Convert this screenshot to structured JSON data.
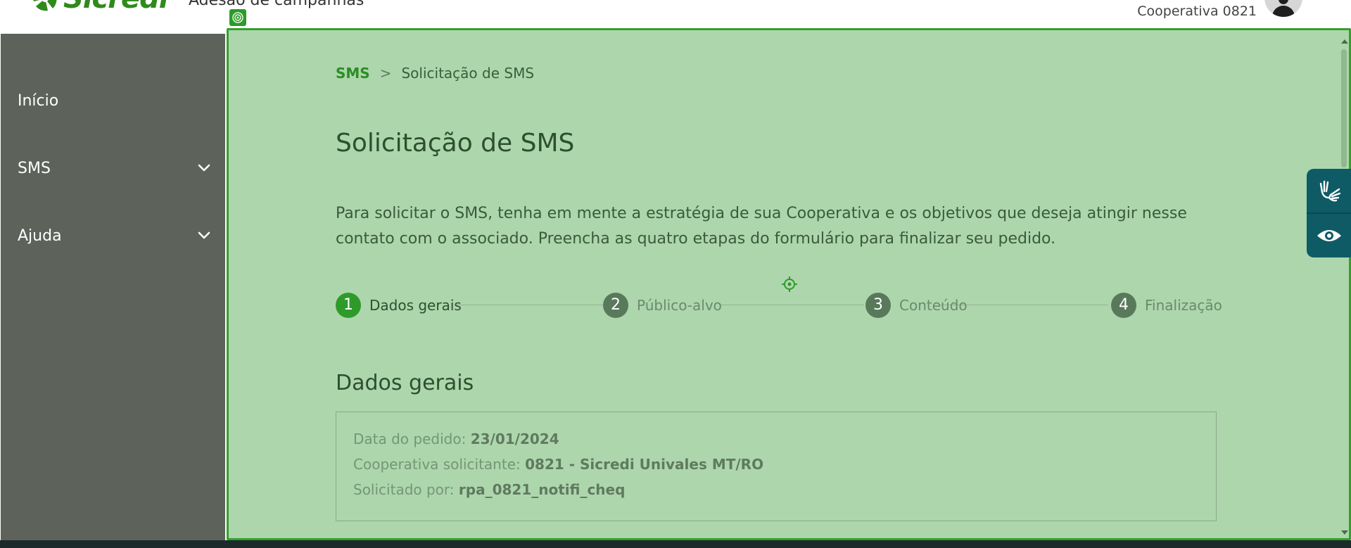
{
  "header": {
    "logo_text": "Sicredi",
    "app_title": "Adesão de campanhas",
    "cooperative": "Cooperativa 0821"
  },
  "sidebar": {
    "items": [
      {
        "label": "Início"
      },
      {
        "label": "SMS"
      },
      {
        "label": "Ajuda"
      }
    ]
  },
  "breadcrumb": {
    "link": "SMS",
    "separator": ">",
    "current": "Solicitação de SMS"
  },
  "main": {
    "title": "Solicitação de SMS",
    "intro": "Para solicitar o SMS, tenha em mente a estratégia de sua Cooperativa e os objetivos que deseja atingir nesse contato com o associado. Preencha as quatro etapas do formulário para finalizar seu pedido."
  },
  "stepper": {
    "steps": [
      {
        "number": "1",
        "label": "Dados gerais",
        "state": "active"
      },
      {
        "number": "2",
        "label": "Público-alvo",
        "state": "inactive"
      },
      {
        "number": "3",
        "label": "Conteúdo",
        "state": "inactive"
      },
      {
        "number": "4",
        "label": "Finalização",
        "state": "inactive"
      }
    ]
  },
  "general": {
    "title": "Dados gerais",
    "fields": [
      {
        "label": "Data do pedido:",
        "value": "23/01/2024"
      },
      {
        "label": "Cooperativa solicitante:",
        "value": "0821 - Sicredi Univales MT/RO"
      },
      {
        "label": "Solicitado por:",
        "value": "rpa_0821_notifi_cheq"
      }
    ]
  },
  "accessibility": {
    "icons": [
      "sign-language-icon",
      "eye-icon"
    ]
  },
  "colors": {
    "brand_green": "#2f8a1b",
    "overlay": "#add6ad",
    "sidebar": "#5d635b",
    "a11y_panel": "#0e5b65"
  }
}
